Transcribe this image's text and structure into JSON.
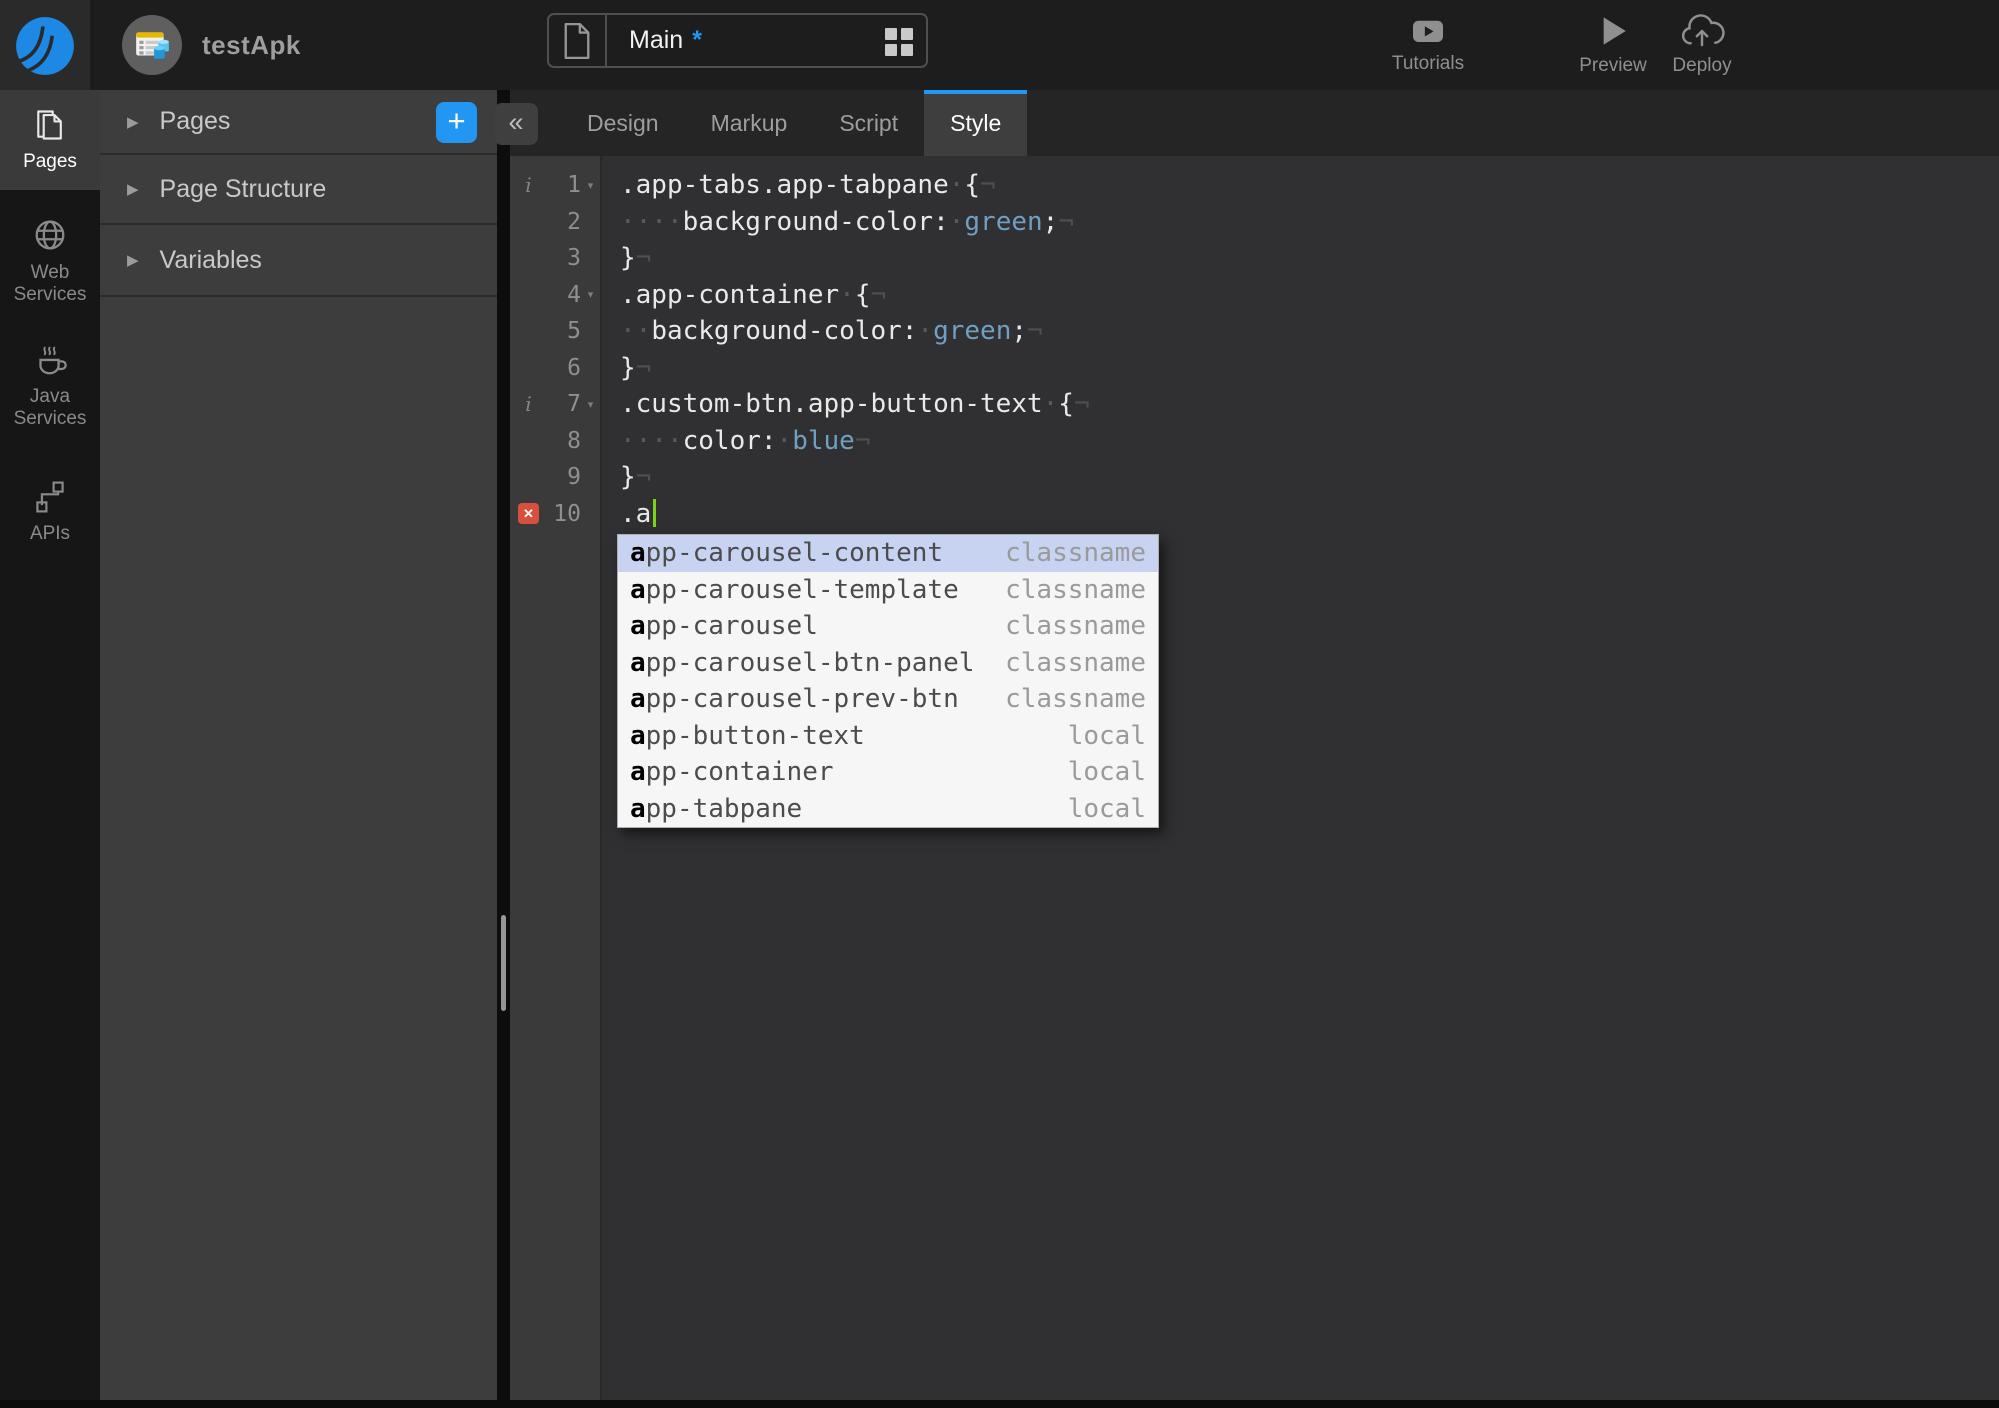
{
  "colors": {
    "accent": "#2196f3",
    "cursor": "#7bd41c",
    "error": "#d94f3d",
    "value_token": "#6f9fc1",
    "selected_row": "#c8d3f2"
  },
  "topbar": {
    "app_name": "testApk",
    "page": {
      "name": "Main",
      "modified_marker": "*"
    },
    "actions": [
      {
        "label": "Tutorials",
        "icon": "youtube-icon"
      },
      {
        "label": "Preview",
        "icon": "play-icon"
      },
      {
        "label": "Deploy",
        "icon": "cloud-upload-icon"
      }
    ]
  },
  "sidebar": {
    "items": [
      {
        "label": "Pages",
        "icon": "pages-icon",
        "active": true
      },
      {
        "label": "Web Services",
        "icon": "globe-icon",
        "active": false
      },
      {
        "label": "Java Services",
        "icon": "coffee-icon",
        "active": false
      },
      {
        "label": "APIs",
        "icon": "api-nodes-icon",
        "active": false
      }
    ]
  },
  "panel": {
    "sections": [
      {
        "label": "Pages",
        "has_add_button": true
      },
      {
        "label": "Page Structure"
      },
      {
        "label": "Variables"
      }
    ],
    "add_button_glyph": "+",
    "collapse_glyph": "«"
  },
  "tabs": [
    {
      "label": "Design",
      "active": false
    },
    {
      "label": "Markup",
      "active": false
    },
    {
      "label": "Script",
      "active": false
    },
    {
      "label": "Style",
      "active": true
    }
  ],
  "editor": {
    "lines": [
      {
        "n": "1",
        "info": true,
        "fold": true,
        "error": false,
        "segs": [
          [
            "p",
            ".app-tabs.app-tabpane"
          ],
          [
            "w",
            "·"
          ],
          [
            "p",
            "{"
          ],
          [
            "x",
            "¬"
          ]
        ]
      },
      {
        "n": "2",
        "info": false,
        "fold": false,
        "error": false,
        "segs": [
          [
            "w",
            "····"
          ],
          [
            "p",
            "background-color:"
          ],
          [
            "w",
            "·"
          ],
          [
            "v",
            "green"
          ],
          [
            "p",
            ";"
          ],
          [
            "x",
            "¬"
          ]
        ]
      },
      {
        "n": "3",
        "info": false,
        "fold": false,
        "error": false,
        "segs": [
          [
            "p",
            "}"
          ],
          [
            "x",
            "¬"
          ]
        ]
      },
      {
        "n": "4",
        "info": false,
        "fold": true,
        "error": false,
        "segs": [
          [
            "p",
            ".app-container"
          ],
          [
            "w",
            "·"
          ],
          [
            "p",
            "{"
          ],
          [
            "x",
            "¬"
          ]
        ]
      },
      {
        "n": "5",
        "info": false,
        "fold": false,
        "error": false,
        "segs": [
          [
            "w",
            "··"
          ],
          [
            "p",
            "background-color:"
          ],
          [
            "w",
            "·"
          ],
          [
            "v",
            "green"
          ],
          [
            "p",
            ";"
          ],
          [
            "x",
            "¬"
          ]
        ]
      },
      {
        "n": "6",
        "info": false,
        "fold": false,
        "error": false,
        "segs": [
          [
            "p",
            "}"
          ],
          [
            "x",
            "¬"
          ]
        ]
      },
      {
        "n": "7",
        "info": true,
        "fold": true,
        "error": false,
        "segs": [
          [
            "p",
            ".custom-btn.app-button-text"
          ],
          [
            "w",
            "·"
          ],
          [
            "p",
            "{"
          ],
          [
            "x",
            "¬"
          ]
        ]
      },
      {
        "n": "8",
        "info": false,
        "fold": false,
        "error": false,
        "segs": [
          [
            "w",
            "····"
          ],
          [
            "p",
            "color:"
          ],
          [
            "w",
            "·"
          ],
          [
            "v",
            "blue"
          ],
          [
            "x",
            "¬"
          ]
        ]
      },
      {
        "n": "9",
        "info": false,
        "fold": false,
        "error": false,
        "segs": [
          [
            "p",
            "}"
          ],
          [
            "x",
            "¬"
          ]
        ]
      },
      {
        "n": "10",
        "info": false,
        "fold": false,
        "error": true,
        "segs": [
          [
            "p",
            ".a"
          ],
          [
            "cur",
            ""
          ]
        ]
      }
    ]
  },
  "autocomplete": {
    "items": [
      {
        "prefix": "a",
        "rest": "pp-carousel-content",
        "kind": "classname",
        "selected": true
      },
      {
        "prefix": "a",
        "rest": "pp-carousel-template",
        "kind": "classname",
        "selected": false
      },
      {
        "prefix": "a",
        "rest": "pp-carousel",
        "kind": "classname",
        "selected": false
      },
      {
        "prefix": "a",
        "rest": "pp-carousel-btn-panel",
        "kind": "classname",
        "selected": false
      },
      {
        "prefix": "a",
        "rest": "pp-carousel-prev-btn",
        "kind": "classname",
        "selected": false
      },
      {
        "prefix": "a",
        "rest": "pp-button-text",
        "kind": "local",
        "selected": false
      },
      {
        "prefix": "a",
        "rest": "pp-container",
        "kind": "local",
        "selected": false
      },
      {
        "prefix": "a",
        "rest": "pp-tabpane",
        "kind": "local",
        "selected": false
      }
    ]
  }
}
